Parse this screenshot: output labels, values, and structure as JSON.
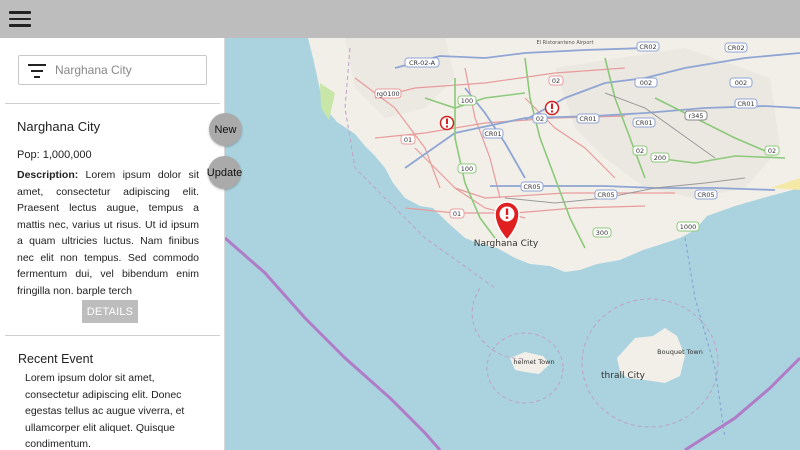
{
  "topbar": {
    "menu_icon": "hamburger-menu-icon"
  },
  "sidebar": {
    "search": {
      "placeholder": "Narghana City",
      "value": "",
      "icon": "filter-icon"
    },
    "city": {
      "name": "Narghana City",
      "pop_label": "Pop:",
      "pop_value": "1,000,000",
      "description_label": "Description:",
      "description": "Lorem ipsum dolor sit amet, consectetur adipiscing elit. Praesent lectus augue, tempus a mattis nec, varius ut risus. Ut id ipsum a quam ultricies luctus. Nam finibus nec elit non tempus. Sed commodo fermentum dui, vel bibendum enim fringilla non. barple terch",
      "details_label": "DETAILS"
    },
    "recent_event": {
      "title": "Recent Event",
      "body": "Lorem ipsum dolor sit amet, consectetur adipiscing elit. Donec egestas tellus ac augue viverra, et ullamcorper elit aliquet. Quisque condimentum."
    }
  },
  "fabs": {
    "new_label": "New",
    "update_label": "Update"
  },
  "map": {
    "city_label": "Narghana City",
    "island_labels": {
      "helmet": "helmet Town",
      "thrall": "thrall City",
      "bouquet": "Bouquet Town"
    },
    "road_labels": [
      "CR-02-A",
      "CR02",
      "002",
      "CR02",
      "002",
      "CR01",
      "100",
      "CR01",
      "02",
      "CR01",
      "CR01",
      "CR01",
      "r345",
      "CR01",
      "100",
      "02",
      "200",
      "CR05",
      "CR05",
      "CR05",
      "01",
      "1000",
      "300",
      "002"
    ],
    "airport_label": "El Ristoranteno Airport",
    "colors": {
      "water": "#aad3df",
      "land": "#f2efe9",
      "road_green": "#8cc97a",
      "road_blue": "#8fa6d4",
      "road_pink": "#e89b9b",
      "boundary": "#b07cc8",
      "marker": "#e02020"
    }
  }
}
